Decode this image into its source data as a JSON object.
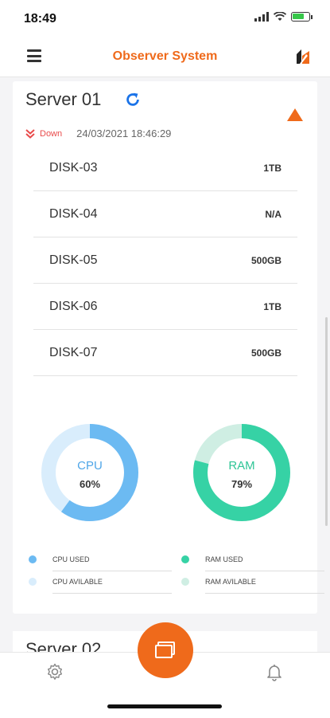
{
  "status_bar": {
    "time": "18:49"
  },
  "header": {
    "title": "Observer System"
  },
  "server": {
    "title": "Server 01",
    "status_label": "Down",
    "timestamp": "24/03/2021 18:46:29",
    "disks": [
      {
        "name": "DISK-03",
        "size": "1TB"
      },
      {
        "name": "DISK-04",
        "size": "N/A"
      },
      {
        "name": "DISK-05",
        "size": "500GB"
      },
      {
        "name": "DISK-06",
        "size": "1TB"
      },
      {
        "name": "DISK-07",
        "size": "500GB"
      }
    ]
  },
  "gauges": {
    "cpu": {
      "label": "CPU",
      "value": "60%",
      "fraction": 0.6,
      "used_color": "#6cbaf2",
      "available_color": "#d9edfc"
    },
    "ram": {
      "label": "RAM",
      "value": "79%",
      "fraction": 0.79,
      "used_color": "#36d2a5",
      "available_color": "#cfeee3"
    }
  },
  "legend": {
    "cpu_used": "CPU USED",
    "cpu_available": "CPU AVILABLE",
    "ram_used": "RAM USED",
    "ram_available": "RAM AVILABLE"
  },
  "next_server": {
    "title": "Server 02"
  },
  "colors": {
    "accent": "#ef6a1b",
    "down": "#e94b4b",
    "refresh": "#1a73e8"
  }
}
